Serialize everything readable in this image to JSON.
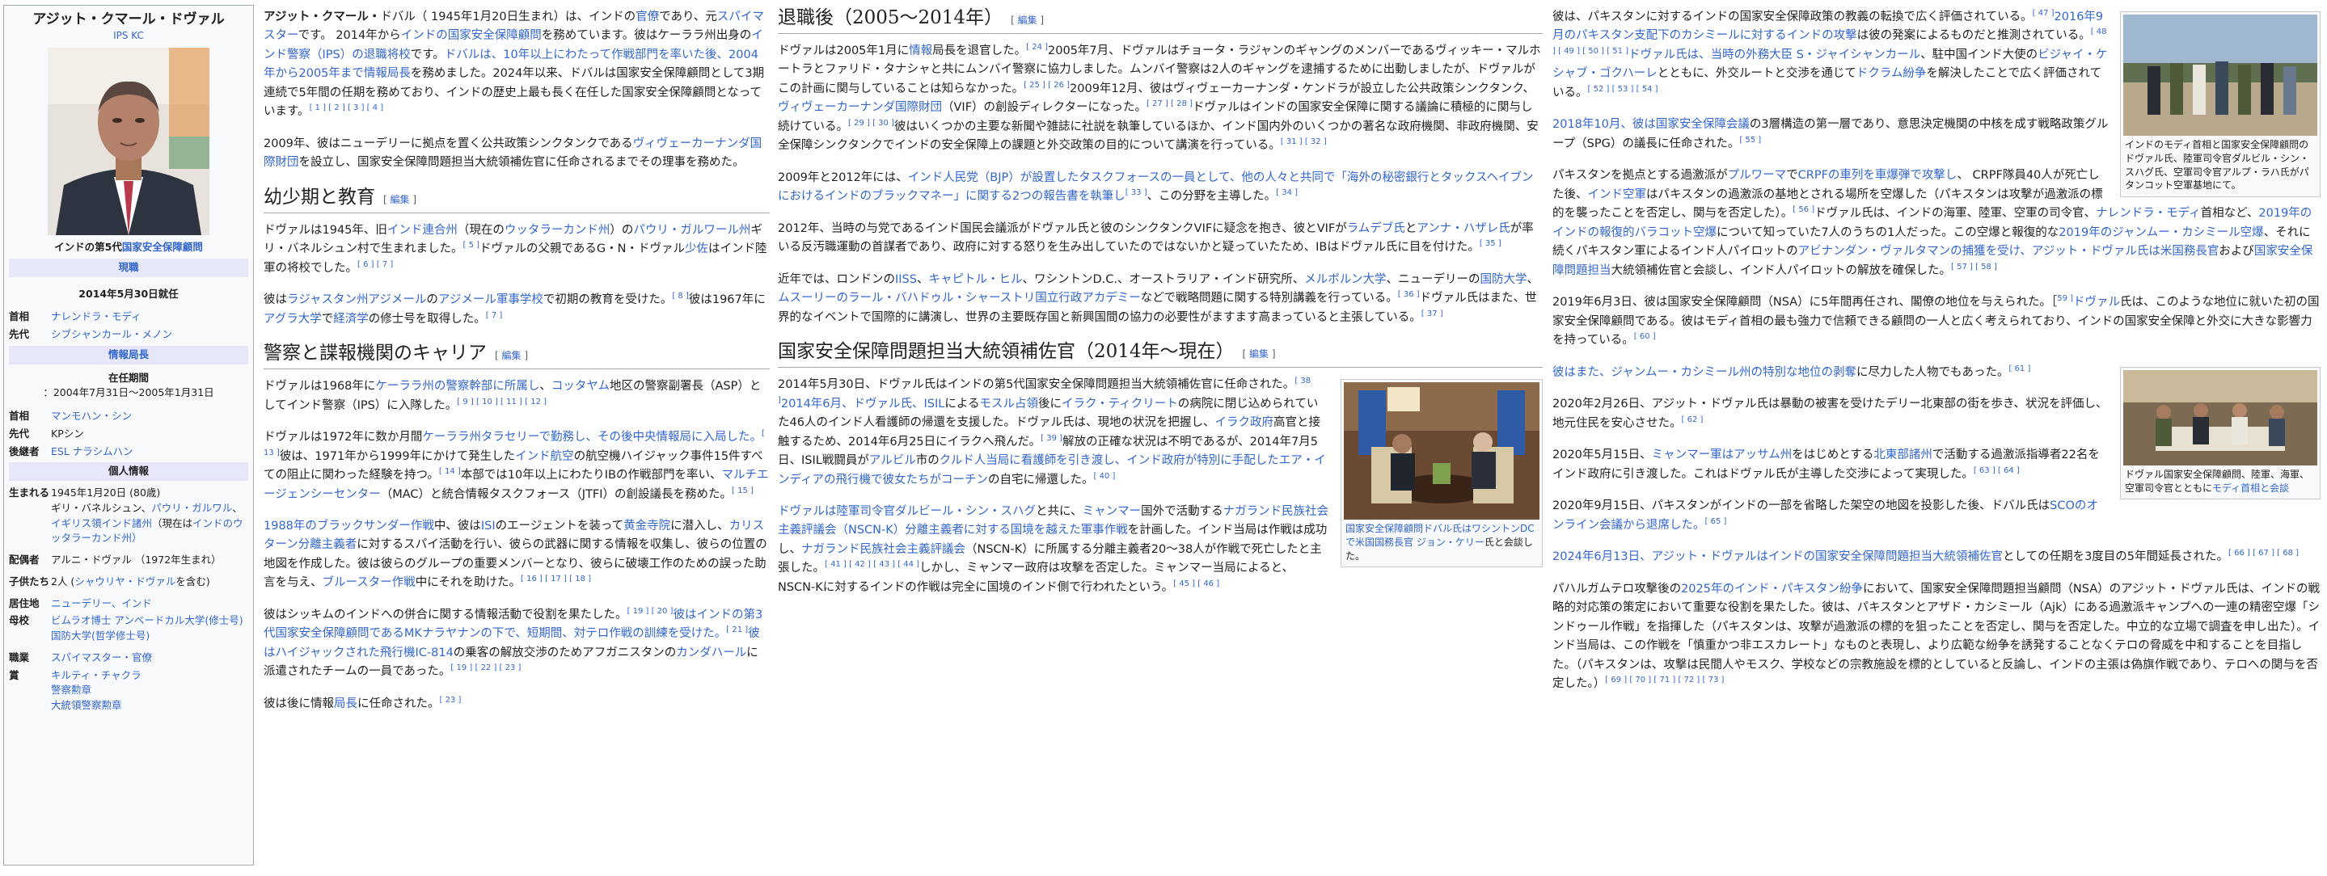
{
  "infobox": {
    "name": "アジット・クマール・ドヴァル",
    "subtitle": "IPS KC",
    "post_caption_a": "インドの第5代",
    "post_caption_link": "国家安全保障顧問",
    "status_band": "現職",
    "since": "2014年5月30日就任",
    "pm_label": "首相",
    "pm_value": "ナレンドラ・モディ",
    "pred_label": "先代",
    "pred_value": "シブシャンカール・メノン",
    "intel_band": "情報局長",
    "term_label": "在任期間",
    "term_value": "：2004年7月31日〜2005年1月31日",
    "pm2_label": "首相",
    "pm2_value": "マンモハン・シン",
    "pred2_label": "先代",
    "pred2_value": "KPシン",
    "succ_label": "後継者",
    "succ_value": "ESL ナラシムハン",
    "personal_band": "個人情報",
    "born_label": "生まれる",
    "born_a": "1945年1月20日 (80歳)",
    "born_b": "ギリ・バネルシュン、",
    "born_c": "パウリ・ガルワル",
    "born_d": "、",
    "born_e": "イギリス領インド諸州",
    "born_f": "（現在は",
    "born_g": "インド",
    "born_h": "のウッタラーカンド州）",
    "spouse_label": "配偶者",
    "spouse_value": "アルニ・ドヴァル （1972年生まれ）",
    "children_label": "子供たち",
    "children_a": "2人 (",
    "children_b": "シャウリヤ・ドヴァル",
    "children_c": "を含む)",
    "residence_label": "居住地",
    "residence_value": "ニューデリー、インド",
    "alma_label": "母校",
    "alma_a": "ビムラオ博士 アンベードカル大学",
    "alma_b": "(修士号)",
    "alma_c": "国防大学",
    "alma_d": "(哲学修士号)",
    "job_label": "職業",
    "job_value": "スパイマスター・官僚",
    "award_label": "賞",
    "award_a": "キルティ・チャクラ",
    "award_b": "警察勲章",
    "award_c": "大統領警察勲章"
  },
  "col1": {
    "lead_1a": "アジット・クマール・",
    "lead_1b": "ドバル（ 1945年1月20日生まれ）は、インドの",
    "lead_1c": "官僚",
    "lead_1d": "であり、元",
    "lead_1e": "スパイマスター",
    "lead_1f": "です。 2014年から",
    "lead_1g": "インドの国家安全保障顧問",
    "lead_1h": "を務めています。彼はケーララ州出身の",
    "lead_1i": "インド警察（IPS）の退職将校",
    "lead_1j": "です。",
    "lead_1k": "ドバルは、10年以上にわたって作戦部門を率いた後、2004年から2005年まで情報局長",
    "lead_1l": "を務めました。2024年以来、ドバルは国家安全保障顧問として3期連続で5年間の任期を務めており、インドの歴史上最も長く在任した国家安全保障顧問となっています。",
    "lead_1m": "[ 1 ] [ 2 ] [ 3 ] [ 4 ]",
    "lead_2a": "2009年、彼はニューデリーに拠点を置く公共政策シンクタンクである",
    "lead_2b": "ヴィヴェーカーナンダ国際財団",
    "lead_2c": "を設立し、国家安全保障問題担当大統領補佐官に任命されるまでその理事を務めた。",
    "h_early": "幼少期と教育",
    "edit": "編集",
    "early_1a": "ドヴァルは1945年、旧",
    "early_1b": "インド連合州",
    "early_1c": "（現在の",
    "early_1d": "ウッタラーカンド州",
    "early_1e": "）の",
    "early_1f": "パウリ・ガルワール州",
    "early_1g": "ギリ・バネルシュン村で生まれました。",
    "early_1h": "[ 5 ]",
    "early_1i": "ドヴァルの父親であるG・N・ドヴァル",
    "early_1j": "少佐",
    "early_1k": "はインド陸軍の将校でした。",
    "early_1l": "[ 6 ] [ 7 ]",
    "early_2a": "彼は",
    "early_2b": "ラジャスタン州アジメール",
    "early_2c": "の",
    "early_2d": "アジメール軍事学校",
    "early_2e": "で初期の教育を受けた。",
    "early_2f": "[ 8 ]",
    "early_2g": "彼は1967年に",
    "early_2h": "アグラ大学",
    "early_2i": "で",
    "early_2j": "経済学",
    "early_2k": "の修士号を取得した。",
    "early_2l": "[ 7 ]",
    "h_police": "警察と諜報機関のキャリア",
    "pol_1a": "ドヴァルは1968年に",
    "pol_1b": "ケーララ州の警察幹部に所属し",
    "pol_1c": "、",
    "pol_1d": "コッタヤム",
    "pol_1e": "地区の警察副署長（ASP）としてインド警察（IPS）に入隊した。",
    "pol_1f": "[ 9 ] [ 10 ] [ 11 ] [ 12 ]",
    "pol_2a": "ドヴァルは1972年に数か月間",
    "pol_2b": "ケーララ州タラセリーで勤務し、その後中央情報局に入局した。",
    "pol_2c": "[ 13 ]",
    "pol_2d": "彼は、1971年から1999年にかけて発生した",
    "pol_2e": "インド航空",
    "pol_2f": "の航空機ハイジャック事件15件すべての阻止に関わった経験を持つ。",
    "pol_2g": "[ 14 ]",
    "pol_2h": "本部では10年以上にわたりIBの作戦部門を率い、",
    "pol_2i": "マルチエージェンシーセンター",
    "pol_2j": "（MAC）と統合情報タスクフォース（JTFI）の創設議長を務めた。",
    "pol_2k": "[ 15 ]",
    "pol_3a": "1988年のブラックサンダー作戦",
    "pol_3b": "中、彼は",
    "pol_3c": "ISI",
    "pol_3d": "のエージェントを装って",
    "pol_3e": "黄金寺院",
    "pol_3f": "に潜入し、",
    "pol_3g": "カリスターン分離主義者",
    "pol_3h": "に対するスパイ活動を行い、彼らの武器に関する情報を収集し、彼らの位置の地図を作成した。彼は彼らのグループの重要メンバーとなり、彼らに破壊工作のための誤った助言を与え、",
    "pol_3i": "ブルースター作戦",
    "pol_3j": "中にそれを助けた。",
    "pol_3k": "[ 16 ] [ 17 ] [ 18 ]",
    "pol_4a": "彼はシッキムのインドへの併合に関する情報活動で役割を果たした。",
    "pol_4b": "[ 19 ] [ 20 ]",
    "pol_4c": "彼はインドの第3代国家安全保障顧問であるMKナラヤナンの下で、短期間、対テロ作戦の訓練を受けた。",
    "pol_4d": "[ 21 ]",
    "pol_4e": "彼はハイジャックされた飛行機IC-814",
    "pol_4f": "の乗客の解放交渉のためアフガニスタンの",
    "pol_4g": "カンダハール",
    "pol_4h": "に派遣されたチームの一員であった。",
    "pol_4i": "[ 19 ] [ 22 ] [ 23 ]",
    "pol_5a": "彼は後に情報",
    "pol_5b": "局長",
    "pol_5c": "に任命された。",
    "pol_5d": "[ 23 ]"
  },
  "col2": {
    "h_retire": "退職後（2005〜2014年）",
    "ret_1a": "ドヴァルは2005年1月に",
    "ret_1b": "情報",
    "ret_1c": "局長を退官した。",
    "ret_1d": "[ 24 ]",
    "ret_1e": "2005年7月、ドヴァルはチョータ・ラジャンのギャングのメンバーであるヴィッキー・マルホートラとファリド・タナシャと共にムンバイ警察に協力しました。ムンバイ警察は2人のギャングを逮捕するために出動しましたが、ドヴァルがこの計画に関与していることは知らなかった。",
    "ret_1f": "[ 25 ] [ 26 ]",
    "ret_1g": "2009年12月、彼はヴィヴェーカーナンダ・ケンドラが設立した公共政策シンクタンク、",
    "ret_1h": "ヴィヴェーカーナンダ国際財団",
    "ret_1i": "（VIF）の創設ディレクターになった。",
    "ret_1j": "[ 27 ] [ 28 ]",
    "ret_1k": "ドヴァルはインドの国家安全保障に関する議論に積極的に関与し続けている。",
    "ret_1l": "[ 29 ] [ 30 ]",
    "ret_1m": "彼はいくつかの主要な新聞や雑誌に社説を執筆しているほか、インド国内外のいくつかの著名な政府機関、非政府機関、安全保障シンクタンクでインドの安全保障上の課題と外交政策の目的について講演を行っている。",
    "ret_1n": "[ 31 ] [ 32 ]",
    "ret_2a": "2009年と2012年には、",
    "ret_2b": "インド人民党（BJP）が設置したタスクフォースの一員として、他の人々と共同で「海外の秘密銀行とタックスヘイブンにおけるインドのブラックマネー」に関する2つの報告書を執筆し",
    "ret_2c": "[ 33 ]",
    "ret_2d": "、この分野を主導した。",
    "ret_2e": "[ 34 ]",
    "ret_3a": "2012年、当時の与党であるインド国民会議派がドヴァル氏と彼のシンクタンクVIFに疑念を抱き、彼とVIFが",
    "ret_3b": "ラムデブ氏",
    "ret_3c": "と",
    "ret_3d": "アンナ・ハザレ氏",
    "ret_3e": "が率いる反汚職運動の首謀者であり、政府に対する怒りを生み出していたのではないかと疑っていたため、IBはドヴァル氏に目を付けた。",
    "ret_3f": "[ 35 ]",
    "ret_4a": "近年では、ロンドンの",
    "ret_4b": "IISS",
    "ret_4c": "、",
    "ret_4d": "キャピトル・ヒル",
    "ret_4e": "、ワシントンD.C.、オーストラリア・インド研究所、",
    "ret_4f": "メルボルン大学",
    "ret_4g": "、ニューデリーの",
    "ret_4h": "国防大学",
    "ret_4i": "、",
    "ret_4j": "ムスーリーのラール・バハドゥル・シャーストリ国立行政アカデミー",
    "ret_4k": "などで戦略問題に関する特別講義を行っている。",
    "ret_4l": "[ 36 ]",
    "ret_4m": "ドヴァル氏はまた、世界的なイベントで国際的に講演し、世界の主要既存国と新興国間の協力の必要性がますます高まっていると主張している。",
    "ret_4n": "[ 37 ]",
    "h_nsa": "国家安全保障問題担当大統領補佐官（2014年〜現在）",
    "thumb1_a": "国家安全保障顧問ドバル氏はワシントンDCで",
    "thumb1_b": "米国国務長官 ジョン・ケリー",
    "thumb1_c": "氏と会談した。",
    "nsa_1a": "2014年5月30日、ドヴァル氏はインドの第5代国家安全保障問題担当大統領補佐官に任命された。",
    "nsa_1b": "[ 38 ]",
    "nsa_1c": "2014年6月、ドヴァル氏、ISIL",
    "nsa_1d": "による",
    "nsa_1e": "モスル占領",
    "nsa_1f": "後に",
    "nsa_1g": "イラク・ティクリート",
    "nsa_1h": "の病院に閉じ込められていた46人のインド人看護師の帰還を支援した。ドヴァル氏は、現地の状況を把握し、",
    "nsa_1i": "イラク政府",
    "nsa_1j": "高官と接触するため、2014年6月25日にイラクへ飛んだ。",
    "nsa_1k": "[ 39 ]",
    "nsa_1l": "解放の正確な状況は不明であるが、2014年7月5日、ISIL戦闘員が",
    "nsa_1m": "アルビル",
    "nsa_1n": "市の",
    "nsa_1o": "クルド人当局に看護師を引き渡し、インド政府が特別に手配したエア・インディアの飛行機で彼女たちがコーチン",
    "nsa_1p": "の自宅に帰還した。",
    "nsa_1q": "[ 40 ]",
    "nsa_2a": "ドヴァルは陸軍司令官",
    "nsa_2b": "ダルビール・シン・スハグ",
    "nsa_2c": "と共に、",
    "nsa_2d": "ミャンマー",
    "nsa_2e": "国外で活動する",
    "nsa_2f": "ナガランド民族社会主義評議会（NSCN-K）分離主義者に対する国境を越えた軍事作戦",
    "nsa_2g": "を計画した。インド当局は作戦は成功し、",
    "nsa_2h": "ナガランド民族社会主義評議会",
    "nsa_2i": "（NSCN-K）に所属する分離主義者20〜38人が作戦で死亡したと主張した。",
    "nsa_2j": "[ 41 ] [ 42 ] [ 43 ] [ 44 ]",
    "nsa_2k": "しかし、ミャンマー政府は攻撃を否定した。ミャンマー当局によると、NSCN-Kに対するインドの作戦は完全に国境のインド側で行われたという。",
    "nsa_2l": "[ 45 ] [ 46 ]"
  },
  "col3": {
    "thumb2": "インドのモディ首相と国家安全保障顧問のドヴァル氏、陸軍司令官ダルビル・シン・スハグ氏、空軍司令官アルプ・ラハ氏がパタンコット空軍基地にて。",
    "thumb3_a": "ドヴァル国家安全保障顧問、陸軍、海軍、空軍司令官とともに",
    "thumb3_b": "モディ首相と会談",
    "c3_1a": "彼は、パキスタンに対するインドの国家安全保障政策の教義の転換で広く評価されている。",
    "c3_1b": "[ 47 ]",
    "c3_1c": "2016年9月のパキスタン支配下のカシミールに対するインドの攻撃",
    "c3_1d": "は彼の発案によるものだと推測されている。",
    "c3_1e": "[ 48 ] [ 49 ] [ 50 ] [ 51 ]",
    "c3_1f": "ドヴァル氏は、当時の外務大臣 S・ジャイシャンカール",
    "c3_1g": "、駐中国インド大使の",
    "c3_1h": "ビジャイ・ケシャブ・ゴクハーレ",
    "c3_1i": "とともに、外交ルートと交渉を通じて",
    "c3_1j": "ドクラム紛争",
    "c3_1k": "を解決したことで広く評価されている。",
    "c3_1l": "[ 52 ] [ 53 ] [ 54 ]",
    "c3_2a": "2018年10月、彼は国家安全保障会議",
    "c3_2b": "の3層構造の第一層であり、意思決定機関の中核を成す戦略政策グループ（SPG）の議長に任命された。",
    "c3_2c": "[ 55 ]",
    "c3_3a": "パキスタンを拠点とする過激派が",
    "c3_3b": "プルワーマ",
    "c3_3c": "で",
    "c3_3d": "CRPFの車列を車爆弾で攻撃し",
    "c3_3e": "、 CRPF隊員40人が死亡した後、",
    "c3_3f": "インド空軍",
    "c3_3g": "はパキスタンの過激派の基地とされる場所を空爆した（パキスタンは攻撃が過激派の標的を襲ったことを否定し、関与を否定した）。",
    "c3_3h": "[ 56 ]",
    "c3_3i": "ドヴァル氏は、インドの海軍、陸軍、空軍の司令官、",
    "c3_3j": "ナレンドラ・モディ",
    "c3_3k": "首相など、",
    "c3_3l": "2019年のインドの報復的バラコット空爆",
    "c3_3m": "について知っていた7人のうちの1人だった。この空爆と報復的な",
    "c3_3n": "2019年のジャンムー・カシミール空爆",
    "c3_3o": "、それに続くパキスタン軍によるインド人パイロットの",
    "c3_3p": "アビナンダン・ヴァルタマンの捕獲を受け、アジット・ドヴァル氏は米国務長官",
    "c3_3q": "および",
    "c3_3r": "国家安全保障問題担当",
    "c3_3s": "大統領補佐官と会談し、インド人パイロットの解放を確保した。",
    "c3_3t": "[ 57 ] [ 58 ]",
    "c3_4a": "2019年6月3日、彼は国家安全保障顧問（NSA）に5年間再任され、閣僚の地位を与えられた。［",
    "c3_4b": "59 ]",
    "c3_4c": "ドヴァル",
    "c3_4d": "氏は、このような地位に就いた初の国家安全保障顧問である。彼はモディ首相の最も強力で信頼できる顧問の一人と広く考えられており、インドの国家安全保障と外交に大きな影響力を持っている。",
    "c3_4e": "[ 60 ]",
    "c3_5a": "彼はまた、ジャンムー・カシミール州の特別な地位の剥奪",
    "c3_5b": "に尽力した人物でもあった。",
    "c3_5c": "[ 61 ]",
    "c3_6a": "2020年2月26日、アジット・ドヴァル氏は暴動の被害を受けたデリー北東部の街を歩き、状況を評価し、地元住民を安心させた。",
    "c3_6b": "[ 62 ]",
    "c3_7a": "2020年5月15日、",
    "c3_7b": "ミャンマー軍はアッサム州",
    "c3_7c": "をはじめとする",
    "c3_7d": "北東部諸州",
    "c3_7e": "で活動する過激派指導者22名をインド政府に引き渡した。これはドヴァル氏が主導した交渉によって実現した。",
    "c3_7f": "[ 63 ] [ 64 ]",
    "c3_8a": "2020年9月15日、パキスタンがインドの一部を省略した架空の地図を投影した後、ドバル氏は",
    "c3_8b": "SCOのオンライン会議から退席した。",
    "c3_8c": "[ 65 ]",
    "c3_9a": "2024年6月13日、アジット・ドヴァルはインドの国家安全保障問題担当大統領補佐官",
    "c3_9b": "としての任期を3度目の5年間延長された。",
    "c3_9c": "[ 66 ] [ 67 ] [ 68 ]",
    "c3_10a": "パハルガムテロ攻撃後の",
    "c3_10b": "2025年のインド・パキスタン紛争",
    "c3_10c": "において、国家安全保障問題担当顧問（NSA）のアジット・ドヴァル氏は、インドの戦略的対応策の策定において重要な役割を果たした。彼は、パキスタンとアザド・カシミール（Ajk）にある過激派キャンプへの一連の精密空爆「シンドゥール作戦」を指揮した（パキスタンは、攻撃が過激派の標的を狙ったことを否定し、関与を否定した。中立的な立場で調査を申し出た）。インド当局は、この作戦を「慎重かつ非エスカレート」なものと表現し、より広範な紛争を誘発することなくテロの脅威を中和することを目指した。（パキスタンは、攻撃は民間人やモスク、学校などの宗教施設を標的としていると反論し、インドの主張は偽旗作戦であり、テロへの関与を否定した。）",
    "c3_10d": "[ 69 ] [ 70 ] [ 71 ] [ 72 ] [ 73 ]"
  },
  "colors": {
    "link": "#3366cc",
    "text": "#202122",
    "infobox_band": "#e6e8fa",
    "border": "#a2a9b1"
  }
}
